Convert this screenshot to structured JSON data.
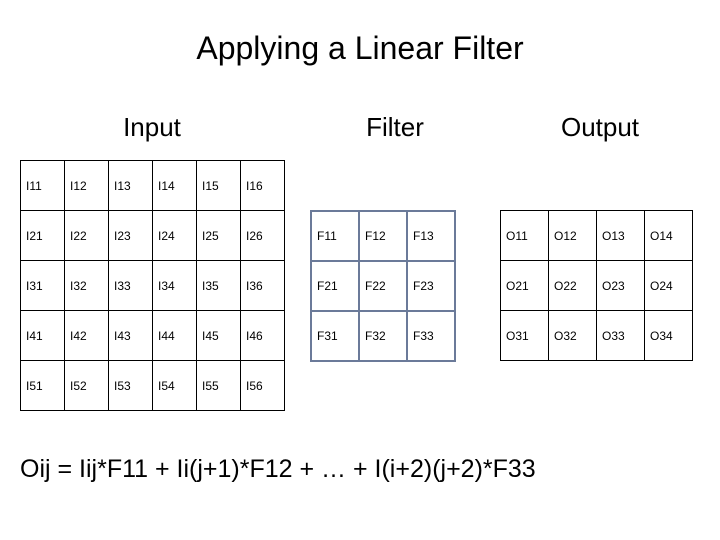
{
  "title": "Applying a Linear Filter",
  "labels": {
    "input": "Input",
    "filter": "Filter",
    "output": "Output"
  },
  "input_grid": [
    [
      "I11",
      "I12",
      "I13",
      "I14",
      "I15",
      "I16"
    ],
    [
      "I21",
      "I22",
      "I23",
      "I24",
      "I25",
      "I26"
    ],
    [
      "I31",
      "I32",
      "I33",
      "I34",
      "I35",
      "I36"
    ],
    [
      "I41",
      "I42",
      "I43",
      "I44",
      "I45",
      "I46"
    ],
    [
      "I51",
      "I52",
      "I53",
      "I54",
      "I55",
      "I56"
    ]
  ],
  "filter_grid": [
    [
      "F11",
      "F12",
      "F13"
    ],
    [
      "F21",
      "F22",
      "F23"
    ],
    [
      "F31",
      "F32",
      "F33"
    ]
  ],
  "output_grid": [
    [
      "O11",
      "O12",
      "O13",
      "O14"
    ],
    [
      "O21",
      "O22",
      "O23",
      "O24"
    ],
    [
      "O31",
      "O32",
      "O33",
      "O34"
    ]
  ],
  "equation": "Oij = Iij*F11 + Ii(j+1)*F12 + … + I(i+2)(j+2)*F33"
}
